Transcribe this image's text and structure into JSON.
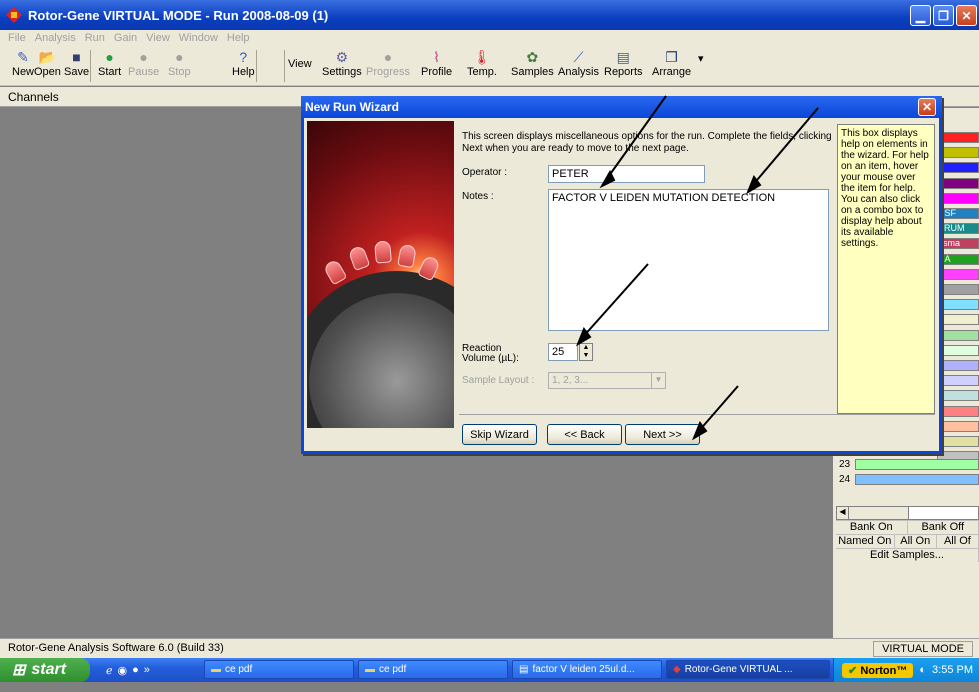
{
  "window": {
    "title": "Rotor-Gene VIRTUAL MODE - Run 2008-08-09 (1)"
  },
  "menu": [
    "File",
    "Analysis",
    "Run",
    "Gain",
    "View",
    "Window",
    "Help"
  ],
  "toolbar": {
    "new": "New",
    "open": "Open",
    "save": "Save",
    "start": "Start",
    "pause": "Pause",
    "stop": "Stop",
    "help": "Help",
    "view": "View",
    "settings": "Settings",
    "progress": "Progress",
    "profile": "Profile",
    "temp": "Temp.",
    "samples": "Samples",
    "analysis": "Analysis",
    "reports": "Reports",
    "arrange": "Arrange"
  },
  "channels_label": "Channels",
  "dialog": {
    "title": "New Run Wizard",
    "intro": "This screen displays miscellaneous options for the run. Complete the fields, clicking Next when you are ready to move to the next page.",
    "operator_label": "Operator :",
    "operator_value": "PETER",
    "notes_label": "Notes :",
    "notes_value": "FACTOR V LEIDEN MUTATION DETECTION",
    "reaction_label_1": "Reaction",
    "reaction_label_2": "Volume (µL):",
    "reaction_value": "25",
    "sample_layout_label": "Sample Layout :",
    "sample_layout_value": "1, 2, 3...",
    "help_text": "This box displays help on elements in the wizard. For help on an item, hover your mouse over the item for help. You can also click on a combo box to display help about its available settings.",
    "skip_button": "Skip Wizard",
    "back_button": "<< Back",
    "next_button": "Next >>"
  },
  "right_panel": {
    "partial_labels": [
      "CSF",
      "ERUM",
      "asma",
      "NA"
    ],
    "rows": [
      "23",
      "24"
    ],
    "bank_on": "Bank On",
    "bank_off": "Bank Off",
    "named_on": "Named On",
    "all_on": "All On",
    "all_off": "All Of",
    "edit_samples": "Edit Samples..."
  },
  "status": {
    "left": "Rotor-Gene Analysis Software 6.0 (Build 33)",
    "right": "VIRTUAL MODE"
  },
  "taskbar": {
    "start": "start",
    "tasks": [
      "ce pdf",
      "ce pdf",
      "factor V leiden 25ul.d...",
      "Rotor-Gene VIRTUAL ..."
    ],
    "norton": "Norton™",
    "time": "3:55 PM"
  },
  "colors": {
    "title_blue": "#0a46d8",
    "help_yellow": "#ffffc0",
    "swatches": [
      "#ff2020",
      "#c0c000",
      "#2020ff",
      "#800080",
      "#ff00ff",
      "#2080c0",
      "#1a8a8a",
      "#c04060",
      "#20a020",
      "#ff40ff",
      "#a0a0a0",
      "#80e0ff",
      "#f0f0d0",
      "#a0e0a0",
      "#e0ffe0",
      "#b0b0ff",
      "#d0d0ff",
      "#c0e0e0",
      "#ff8080",
      "#ffc0a0",
      "#e0e0a0",
      "#c0c0c0",
      "#a0ffa0",
      "#80c0ff"
    ]
  }
}
